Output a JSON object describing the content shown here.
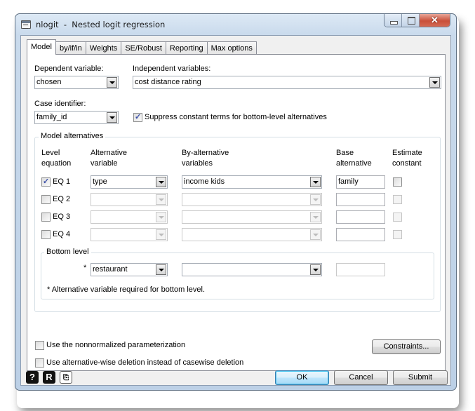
{
  "window": {
    "title": "nlogit  -  Nested logit regression",
    "close_glyph": "✕"
  },
  "tabs": [
    {
      "label": "Model",
      "active": true
    },
    {
      "label": "by/if/in",
      "active": false
    },
    {
      "label": "Weights",
      "active": false
    },
    {
      "label": "SE/Robust",
      "active": false
    },
    {
      "label": "Reporting",
      "active": false
    },
    {
      "label": "Max options",
      "active": false
    }
  ],
  "model": {
    "dependent_label": "Dependent variable:",
    "dependent_value": "chosen",
    "independent_label": "Independent variables:",
    "independent_value": "cost distance rating",
    "case_label": "Case identifier:",
    "case_value": "family_id",
    "suppress_label": "Suppress constant terms for bottom-level alternatives",
    "suppress_checked": true
  },
  "alternatives": {
    "group_title": "Model alternatives",
    "headers": {
      "level_1": "Level",
      "level_2": "equation",
      "alt_1": "Alternative",
      "alt_2": "variable",
      "by_1": "By-alternative",
      "by_2": "variables",
      "base_1": "Base",
      "base_2": "alternative",
      "est_1": "Estimate",
      "est_2": "constant"
    },
    "rows": [
      {
        "label": "EQ 1",
        "checked": true,
        "alt": "type",
        "by": "income kids",
        "base": "family",
        "estimate": false,
        "enabled": true
      },
      {
        "label": "EQ 2",
        "checked": false,
        "alt": "",
        "by": "",
        "base": "",
        "estimate": false,
        "enabled": false
      },
      {
        "label": "EQ 3",
        "checked": false,
        "alt": "",
        "by": "",
        "base": "",
        "estimate": false,
        "enabled": false
      },
      {
        "label": "EQ 4",
        "checked": false,
        "alt": "",
        "by": "",
        "base": "",
        "estimate": false,
        "enabled": false
      }
    ],
    "bottom": {
      "title": "Bottom level",
      "asterisk": "*",
      "alt": "restaurant",
      "by": "",
      "base": "",
      "note": "* Alternative variable required for bottom level."
    }
  },
  "options": {
    "nonnormalized_label": "Use the nonnormalized parameterization",
    "altwise_label": "Use alternative-wise deletion instead of casewise deletion",
    "constraints_label": "Constraints..."
  },
  "footer": {
    "help_glyph": "?",
    "reset_glyph": "R",
    "copy_glyph": "⎘",
    "ok_label": "OK",
    "cancel_label": "Cancel",
    "submit_label": "Submit"
  }
}
